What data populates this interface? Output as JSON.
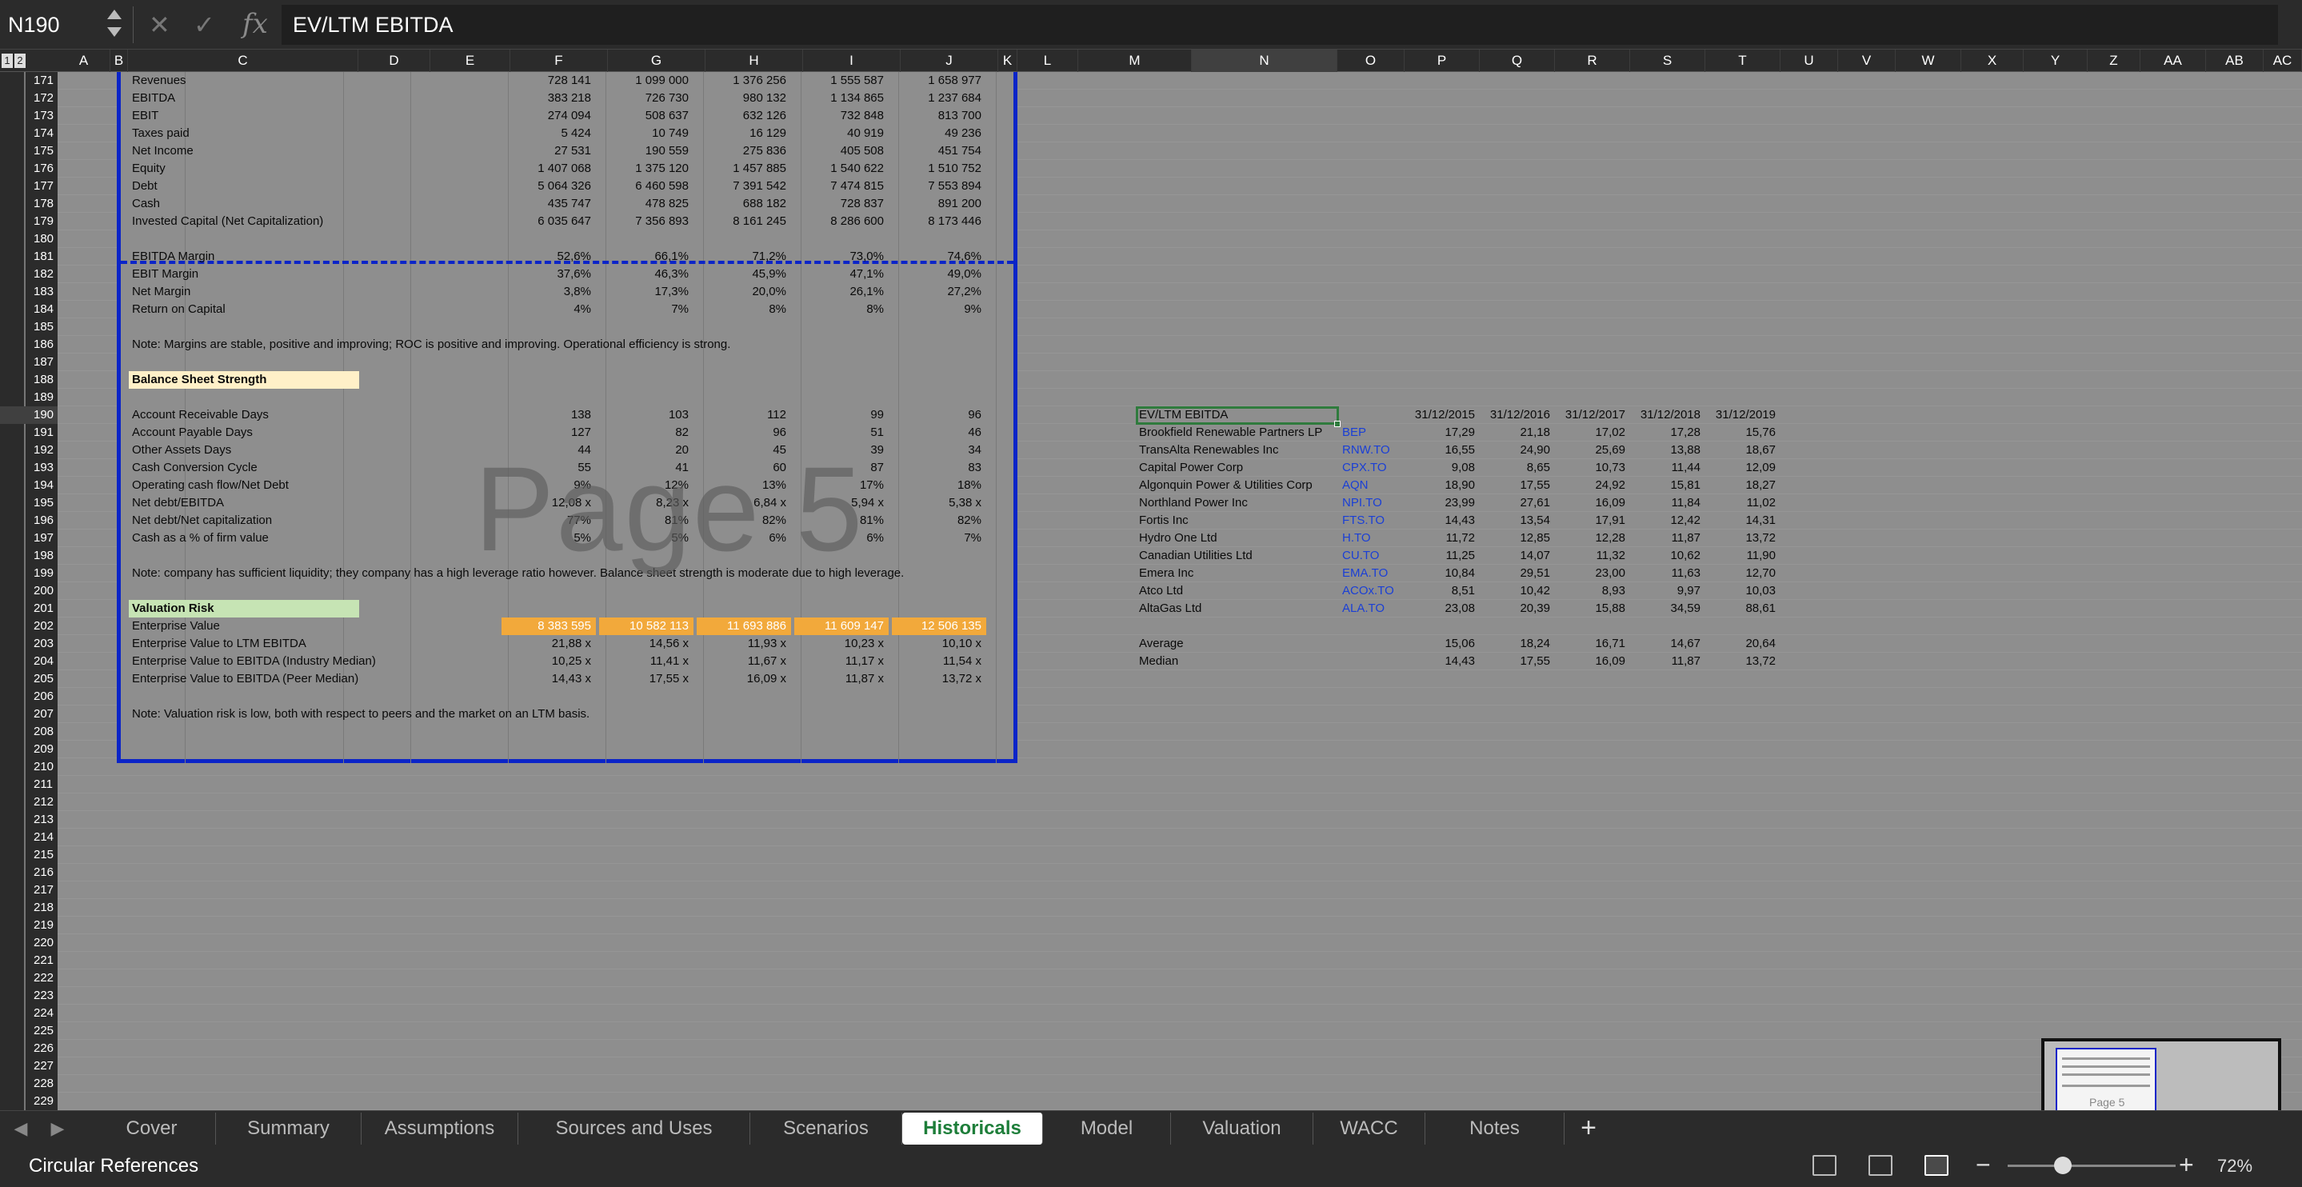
{
  "formula_bar": {
    "name_box": "N190",
    "cancel_icon": "✕",
    "enter_icon": "✓",
    "fx_label": "fx",
    "content": "EV/LTM EBITDA"
  },
  "outline_levels": [
    "1",
    "2"
  ],
  "columns": [
    "A",
    "B",
    "C",
    "D",
    "E",
    "F",
    "G",
    "H",
    "I",
    "J",
    "K",
    "L",
    "M",
    "N",
    "O",
    "P",
    "Q",
    "R",
    "S",
    "T",
    "U",
    "V",
    "W",
    "X",
    "Y",
    "Z",
    "AA",
    "AB",
    "AC"
  ],
  "selected_column": "N",
  "rows": [
    "171",
    "172",
    "173",
    "174",
    "175",
    "176",
    "177",
    "178",
    "179",
    "180",
    "181",
    "182",
    "183",
    "184",
    "185",
    "186",
    "187",
    "188",
    "189",
    "190",
    "191",
    "192",
    "193",
    "194",
    "195",
    "196",
    "197",
    "198",
    "199",
    "200",
    "201",
    "202",
    "203",
    "204",
    "205",
    "206",
    "207",
    "208",
    "209",
    "210",
    "211",
    "212",
    "213",
    "214",
    "215",
    "216",
    "217",
    "218",
    "219",
    "220",
    "221",
    "222",
    "223",
    "224",
    "225",
    "226",
    "227",
    "228",
    "229"
  ],
  "selected_row": "190",
  "financials": [
    {
      "label": "Revenues",
      "values": [
        "728 141",
        "1 099 000",
        "1 376 256",
        "1 555 587",
        "1 658 977"
      ]
    },
    {
      "label": "EBITDA",
      "values": [
        "383 218",
        "726 730",
        "980 132",
        "1 134 865",
        "1 237 684"
      ]
    },
    {
      "label": "EBIT",
      "values": [
        "274 094",
        "508 637",
        "632 126",
        "732 848",
        "813 700"
      ]
    },
    {
      "label": "Taxes paid",
      "values": [
        "5 424",
        "10 749",
        "16 129",
        "40 919",
        "49 236"
      ]
    },
    {
      "label": "Net Income",
      "values": [
        "27 531",
        "190 559",
        "275 836",
        "405 508",
        "451 754"
      ]
    },
    {
      "label": "Equity",
      "values": [
        "1 407 068",
        "1 375 120",
        "1 457 885",
        "1 540 622",
        "1 510 752"
      ]
    },
    {
      "label": "Debt",
      "values": [
        "5 064 326",
        "6 460 598",
        "7 391 542",
        "7 474 815",
        "7 553 894"
      ]
    },
    {
      "label": "Cash",
      "values": [
        "435 747",
        "478 825",
        "688 182",
        "728 837",
        "891 200"
      ]
    },
    {
      "label": "Invested Capital (Net Capitalization)",
      "values": [
        "6 035 647",
        "7 356 893",
        "8 161 245",
        "8 286 600",
        "8 173 446"
      ]
    }
  ],
  "margins": [
    {
      "label": "EBITDA Margin",
      "values": [
        "52,6%",
        "66,1%",
        "71,2%",
        "73,0%",
        "74,6%"
      ]
    },
    {
      "label": "EBIT Margin",
      "values": [
        "37,6%",
        "46,3%",
        "45,9%",
        "47,1%",
        "49,0%"
      ]
    },
    {
      "label": "Net Margin",
      "values": [
        "3,8%",
        "17,3%",
        "20,0%",
        "26,1%",
        "27,2%"
      ]
    },
    {
      "label": "Return on Capital",
      "values": [
        "4%",
        "7%",
        "8%",
        "8%",
        "9%"
      ]
    }
  ],
  "note_margins": "Note: Margins are stable, positive and improving; ROC is positive and improving. Operational efficiency is strong.",
  "balance_title": "Balance Sheet Strength",
  "balance": [
    {
      "label": "Account Receivable Days",
      "values": [
        "138",
        "103",
        "112",
        "99",
        "96"
      ]
    },
    {
      "label": "Account Payable Days",
      "values": [
        "127",
        "82",
        "96",
        "51",
        "46"
      ]
    },
    {
      "label": "Other Assets Days",
      "values": [
        "44",
        "20",
        "45",
        "39",
        "34"
      ]
    },
    {
      "label": "Cash Conversion Cycle",
      "values": [
        "55",
        "41",
        "60",
        "87",
        "83"
      ]
    },
    {
      "label": "Operating cash flow/Net Debt",
      "values": [
        "9%",
        "12%",
        "13%",
        "17%",
        "18%"
      ]
    },
    {
      "label": "Net debt/EBITDA",
      "values": [
        "12,08 x",
        "8,23 x",
        "6,84 x",
        "5,94 x",
        "5,38 x"
      ]
    },
    {
      "label": "Net debt/Net capitalization",
      "values": [
        "77%",
        "81%",
        "82%",
        "81%",
        "82%"
      ]
    },
    {
      "label": "Cash as a % of firm value",
      "values": [
        "5%",
        "5%",
        "6%",
        "6%",
        "7%"
      ]
    }
  ],
  "note_balance": "Note: company has sufficient liquidity; they company has a high leverage ratio however. Balance sheet strength is moderate due to high leverage.",
  "valuation_title": "Valuation Risk",
  "valuation": [
    {
      "label": "Enterprise Value",
      "values": [
        "8 383 595",
        "10 582 113",
        "11 693 886",
        "11 609 147",
        "12 506 135"
      ]
    },
    {
      "label": "Enterprise Value to LTM EBITDA",
      "values": [
        "21,88 x",
        "14,56 x",
        "11,93 x",
        "10,23 x",
        "10,10 x"
      ]
    },
    {
      "label": "Enterprise Value to EBITDA (Industry Median)",
      "values": [
        "10,25 x",
        "11,41 x",
        "11,67 x",
        "11,17 x",
        "11,54 x"
      ]
    },
    {
      "label": "Enterprise Value to EBITDA (Peer Median)",
      "values": [
        "14,43 x",
        "17,55 x",
        "16,09 x",
        "11,87 x",
        "13,72 x"
      ]
    }
  ],
  "note_valuation": "Note: Valuation risk is low, both with respect to peers and the market on an LTM basis.",
  "watermark": "Page 5",
  "peer_table": {
    "title": "EV/LTM EBITDA",
    "dates": [
      "31/12/2015",
      "31/12/2016",
      "31/12/2017",
      "31/12/2018",
      "31/12/2019"
    ],
    "rows": [
      {
        "name": "Brookfield Renewable Partners LP",
        "ticker": "BEP",
        "values": [
          "17,29",
          "21,18",
          "17,02",
          "17,28",
          "15,76"
        ]
      },
      {
        "name": "TransAlta Renewables Inc",
        "ticker": "RNW.TO",
        "values": [
          "16,55",
          "24,90",
          "25,69",
          "13,88",
          "18,67"
        ]
      },
      {
        "name": "Capital Power Corp",
        "ticker": "CPX.TO",
        "values": [
          "9,08",
          "8,65",
          "10,73",
          "11,44",
          "12,09"
        ]
      },
      {
        "name": "Algonquin Power & Utilities Corp",
        "ticker": "AQN",
        "values": [
          "18,90",
          "17,55",
          "24,92",
          "15,81",
          "18,27"
        ]
      },
      {
        "name": "Northland Power Inc",
        "ticker": "NPI.TO",
        "values": [
          "23,99",
          "27,61",
          "16,09",
          "11,84",
          "11,02"
        ]
      },
      {
        "name": "Fortis Inc",
        "ticker": "FTS.TO",
        "values": [
          "14,43",
          "13,54",
          "17,91",
          "12,42",
          "14,31"
        ]
      },
      {
        "name": "Hydro One Ltd",
        "ticker": "H.TO",
        "values": [
          "11,72",
          "12,85",
          "12,28",
          "11,87",
          "13,72"
        ]
      },
      {
        "name": "Canadian Utilities Ltd",
        "ticker": "CU.TO",
        "values": [
          "11,25",
          "14,07",
          "11,32",
          "10,62",
          "11,90"
        ]
      },
      {
        "name": "Emera Inc",
        "ticker": "EMA.TO",
        "values": [
          "10,84",
          "29,51",
          "23,00",
          "11,63",
          "12,70"
        ]
      },
      {
        "name": "Atco Ltd",
        "ticker": "ACOx.TO",
        "values": [
          "8,51",
          "10,42",
          "8,93",
          "9,97",
          "10,03"
        ]
      },
      {
        "name": "AltaGas Ltd",
        "ticker": "ALA.TO",
        "values": [
          "23,08",
          "20,39",
          "15,88",
          "34,59",
          "88,61"
        ]
      }
    ],
    "summary": [
      {
        "name": "Average",
        "values": [
          "15,06",
          "18,24",
          "16,71",
          "14,67",
          "20,64"
        ]
      },
      {
        "name": "Median",
        "values": [
          "14,43",
          "17,55",
          "16,09",
          "11,87",
          "13,72"
        ]
      }
    ]
  },
  "tabs": [
    "Cover",
    "Summary",
    "Assumptions",
    "Sources and Uses",
    "Scenarios",
    "Historicals",
    "Model",
    "Valuation",
    "WACC",
    "Notes"
  ],
  "active_tab": "Historicals",
  "add_sheet": "+",
  "status": {
    "text": "Circular References",
    "zoom": "72%"
  },
  "colors": {
    "print_area_border": "#0b24c8",
    "selection": "#2f7b3d",
    "active_tab_text": "#1e7e3a",
    "ticker": "#1a3fd6",
    "highlight_orange": "#f2a93b"
  }
}
